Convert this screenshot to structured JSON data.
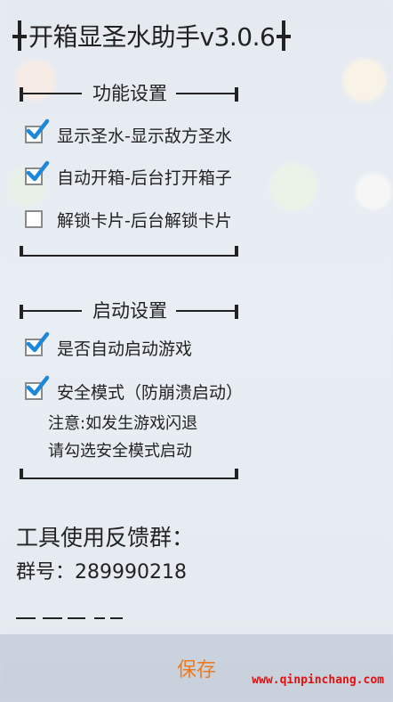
{
  "header": {
    "title": "开箱显圣水助手v3.0.6"
  },
  "sections": {
    "features": {
      "title": "功能设置",
      "options": [
        {
          "label": "显示圣水-显示敌方圣水",
          "checked": true
        },
        {
          "label": "自动开箱-后台打开箱子",
          "checked": true
        },
        {
          "label": "解锁卡片-后台解锁卡片",
          "checked": false
        }
      ]
    },
    "startup": {
      "title": "启动设置",
      "options": [
        {
          "label": "是否自动启动游戏",
          "checked": true
        },
        {
          "label": "安全模式（防崩溃启动）",
          "checked": true
        }
      ],
      "note_line1": "注意:如发生游戏闪退",
      "note_line2": "请勾选安全模式启动"
    }
  },
  "feedback": {
    "title": "工具使用反馈群：",
    "group_number": "群号：289990218"
  },
  "footer": {
    "save_label": "保存",
    "watermark": "www.qinpinchang.com"
  },
  "colors": {
    "checkmark": "#1e88d6",
    "save": "#ee7a1f",
    "watermark": "#e01010"
  }
}
